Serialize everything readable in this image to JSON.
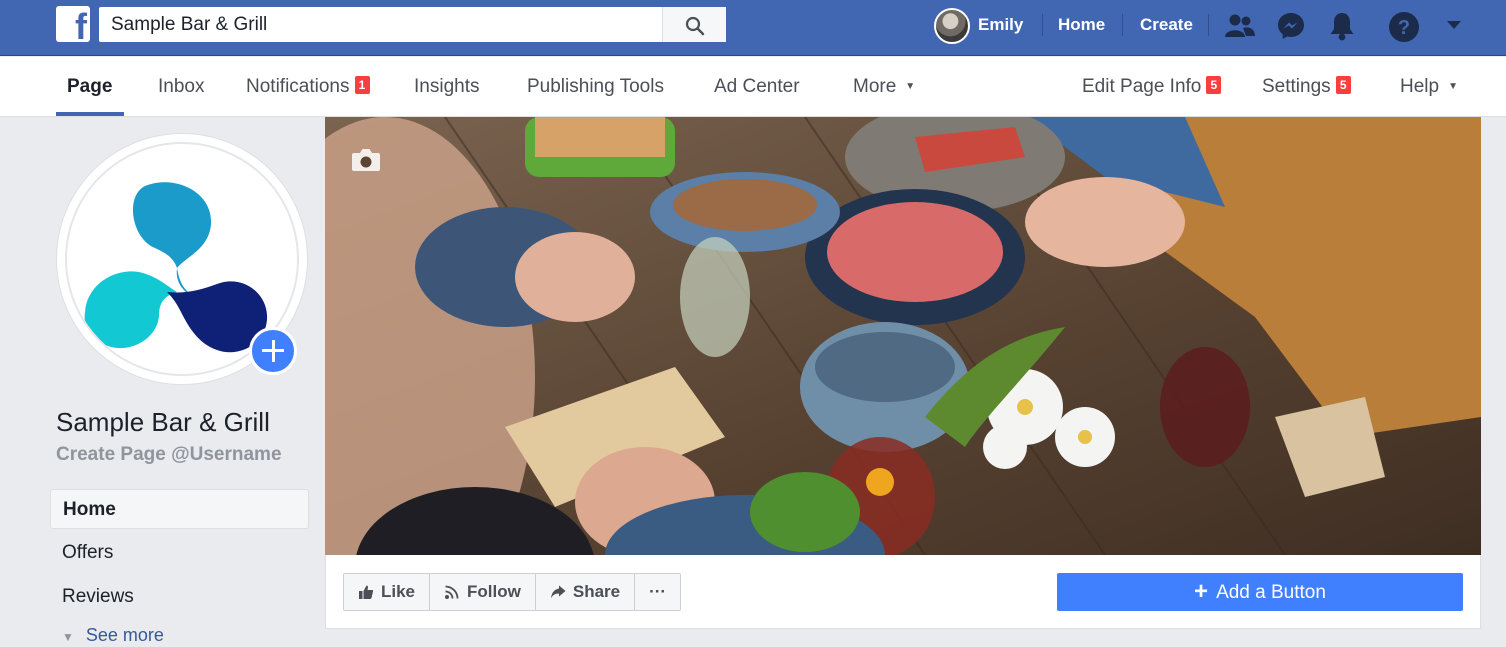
{
  "topbar": {
    "logo": "f",
    "search_value": "Sample Bar & Grill",
    "user_name": "Emily",
    "home_label": "Home",
    "create_label": "Create",
    "icons": [
      "friends-icon",
      "messenger-icon",
      "notifications-bell-icon",
      "help-icon",
      "caret-down-icon"
    ],
    "colors": {
      "bar": "#4267b2",
      "accent": "#4080ff",
      "badge": "#fa3e3e"
    }
  },
  "tabs": {
    "items": [
      {
        "label": "Page"
      },
      {
        "label": "Inbox"
      },
      {
        "label": "Notifications",
        "badge": "1"
      },
      {
        "label": "Insights"
      },
      {
        "label": "Publishing Tools"
      },
      {
        "label": "Ad Center"
      },
      {
        "label": "More"
      }
    ],
    "right": [
      {
        "label": "Edit Page Info",
        "badge": "5"
      },
      {
        "label": "Settings",
        "badge": "5"
      },
      {
        "label": "Help"
      }
    ],
    "active": "Page"
  },
  "profile": {
    "page_name": "Sample Bar & Grill",
    "username_prompt": "Create Page @Username"
  },
  "sidebar": {
    "items": [
      {
        "label": "Home"
      },
      {
        "label": "Offers"
      },
      {
        "label": "Reviews"
      }
    ],
    "active": "Home",
    "see_more": "See more"
  },
  "actions": {
    "like": "Like",
    "follow": "Follow",
    "share": "Share",
    "more": "···",
    "add_button": "Add a Button"
  }
}
